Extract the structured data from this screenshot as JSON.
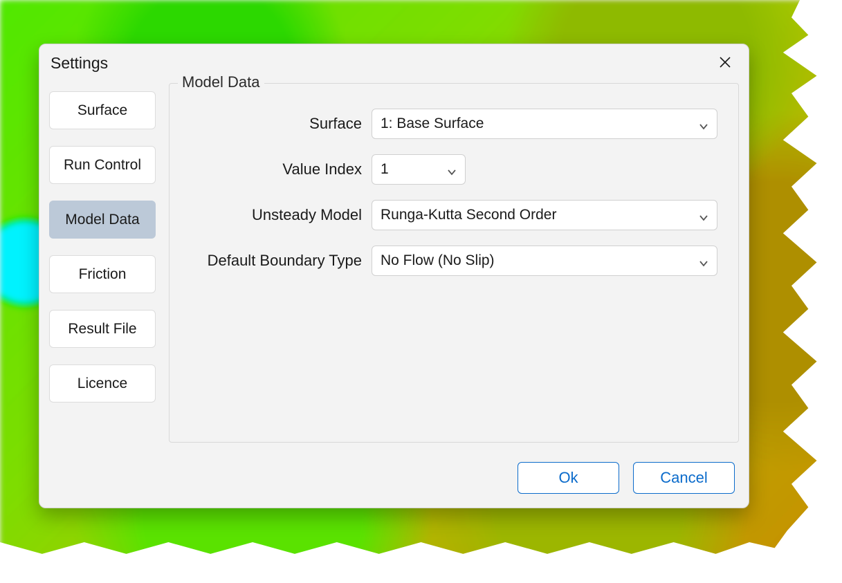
{
  "dialog": {
    "title": "Settings",
    "close_icon": "close"
  },
  "sidebar": {
    "items": [
      {
        "label": "Surface",
        "selected": false
      },
      {
        "label": "Run Control",
        "selected": false
      },
      {
        "label": "Model Data",
        "selected": true
      },
      {
        "label": "Friction",
        "selected": false
      },
      {
        "label": "Result File",
        "selected": false
      },
      {
        "label": "Licence",
        "selected": false
      }
    ]
  },
  "panel": {
    "title": "Model Data",
    "fields": {
      "surface": {
        "label": "Surface",
        "value": "1: Base Surface"
      },
      "value_index": {
        "label": "Value Index",
        "value": "1"
      },
      "unsteady_model": {
        "label": "Unsteady Model",
        "value": "Runga-Kutta Second Order"
      },
      "default_boundary_type": {
        "label": "Default Boundary Type",
        "value": "No Flow (No Slip)"
      }
    }
  },
  "footer": {
    "ok_label": "Ok",
    "cancel_label": "Cancel"
  }
}
